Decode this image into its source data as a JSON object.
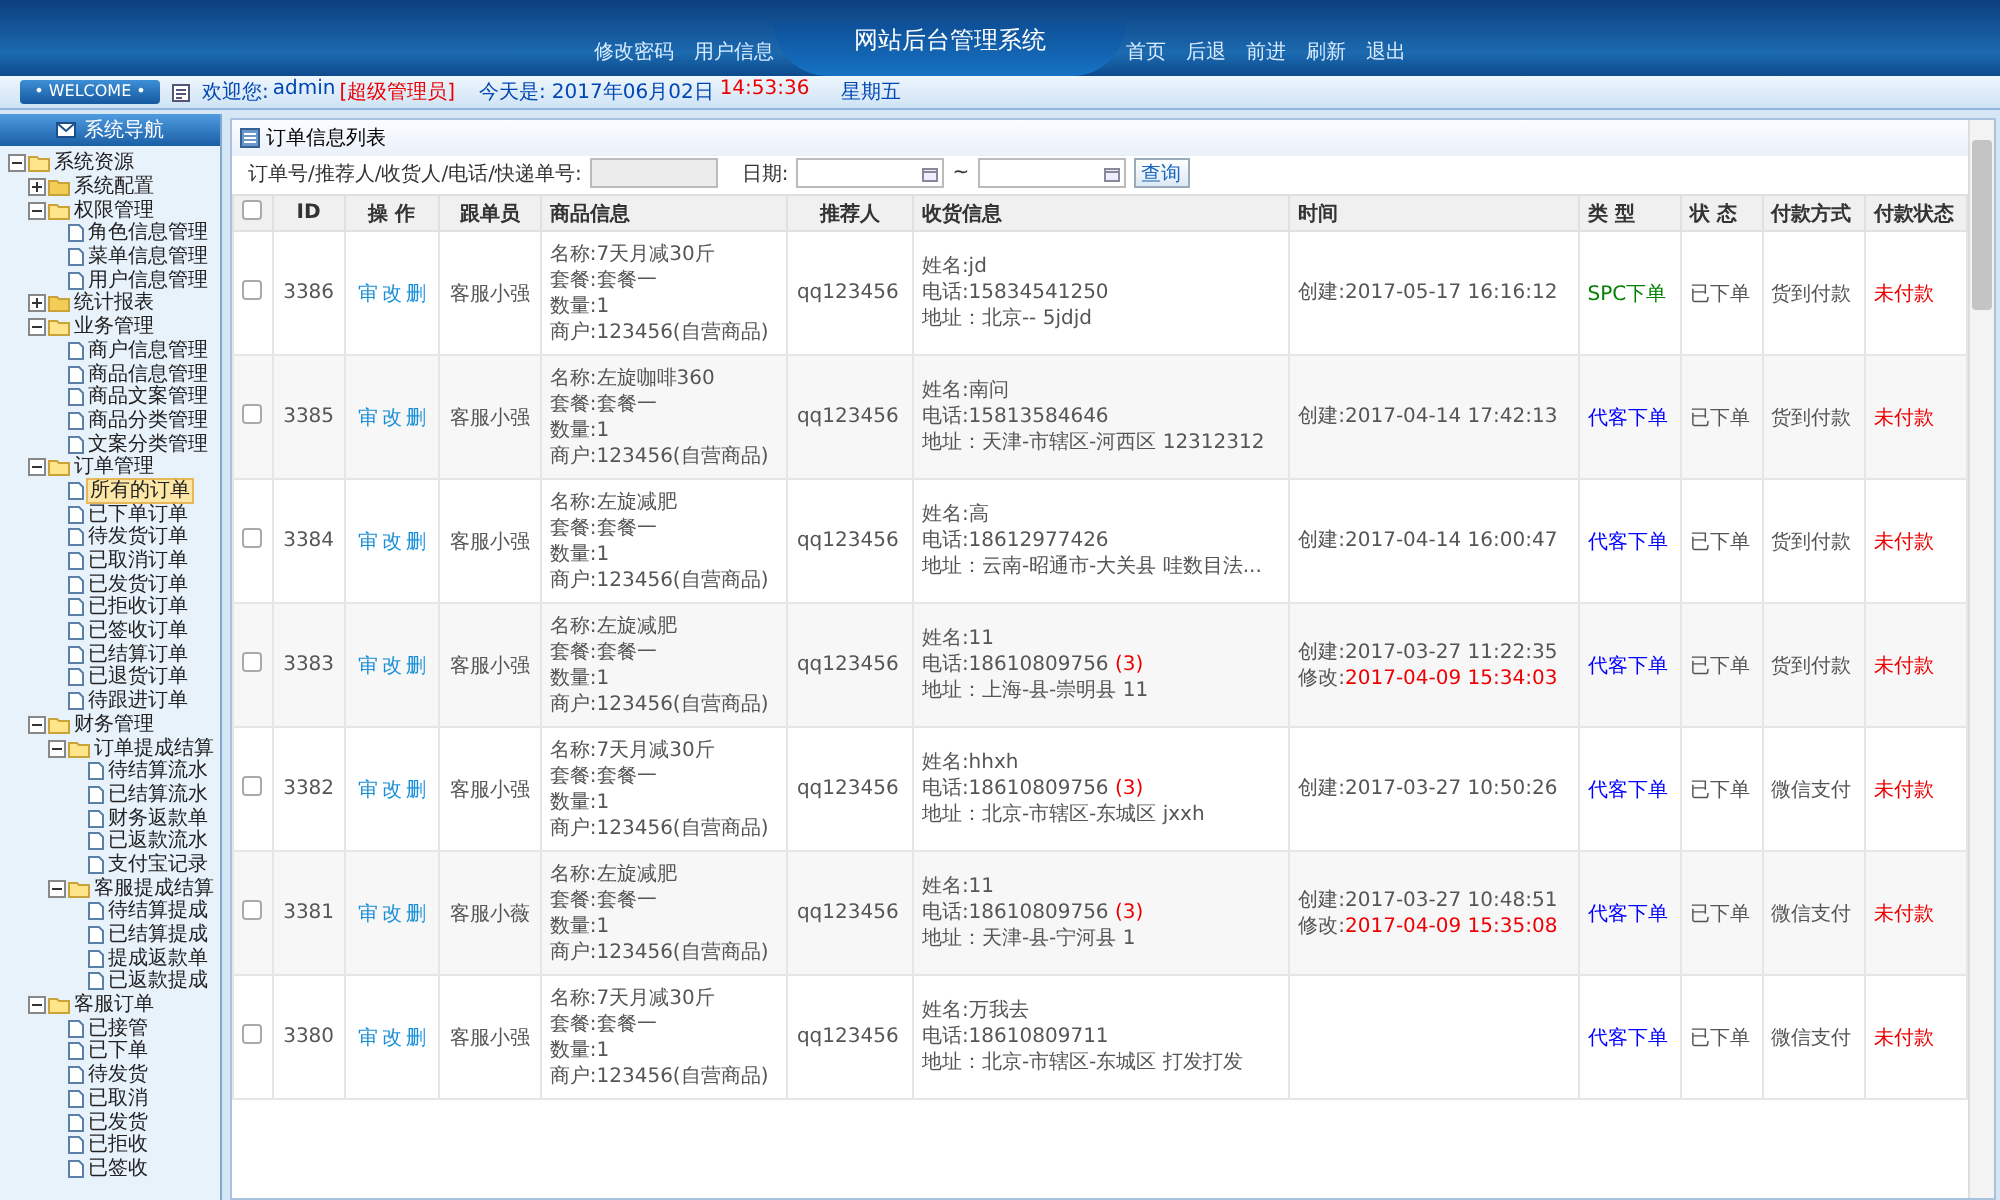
{
  "header": {
    "title": "网站后台管理系统",
    "left_links": [
      "修改密码",
      "用户信息"
    ],
    "right_links": [
      "首页",
      "后退",
      "前进",
      "刷新",
      "退出"
    ]
  },
  "welcome": {
    "badge": "• WELCOME •",
    "greeting": "欢迎您:",
    "user": "admin",
    "role": "[超级管理员]",
    "date_label": "今天是:",
    "date": "2017年06月02日",
    "time": "14:53:36",
    "weekday": "星期五"
  },
  "sidebar": {
    "title": "系统导航",
    "tree": [
      {
        "label": "系统资源",
        "expanded": true,
        "children": [
          {
            "label": "系统配置",
            "expanded": false
          },
          {
            "label": "权限管理",
            "expanded": true,
            "children": [
              {
                "label": "角色信息管理",
                "selected": false
              },
              {
                "label": "菜单信息管理",
                "selected": false
              },
              {
                "label": "用户信息管理",
                "selected": false
              }
            ]
          },
          {
            "label": "统计报表",
            "expanded": false
          },
          {
            "label": "业务管理",
            "expanded": true,
            "children": [
              {
                "label": "商户信息管理",
                "selected": false
              },
              {
                "label": "商品信息管理",
                "selected": false
              },
              {
                "label": "商品文案管理",
                "selected": false
              },
              {
                "label": "商品分类管理",
                "selected": false
              },
              {
                "label": "文案分类管理",
                "selected": false
              }
            ]
          },
          {
            "label": "订单管理",
            "expanded": true,
            "children": [
              {
                "label": "所有的订单",
                "selected": true
              },
              {
                "label": "已下单订单",
                "selected": false
              },
              {
                "label": "待发货订单",
                "selected": false
              },
              {
                "label": "已取消订单",
                "selected": false
              },
              {
                "label": "已发货订单",
                "selected": false
              },
              {
                "label": "已拒收订单",
                "selected": false
              },
              {
                "label": "已签收订单",
                "selected": false
              },
              {
                "label": "已结算订单",
                "selected": false
              },
              {
                "label": "已退货订单",
                "selected": false
              },
              {
                "label": "待跟进订单",
                "selected": false
              }
            ]
          },
          {
            "label": "财务管理",
            "expanded": true,
            "children": [
              {
                "label": "订单提成结算",
                "expanded": true,
                "children": [
                  {
                    "label": "待结算流水",
                    "selected": false
                  },
                  {
                    "label": "已结算流水",
                    "selected": false
                  },
                  {
                    "label": "财务返款单",
                    "selected": false
                  },
                  {
                    "label": "已返款流水",
                    "selected": false
                  },
                  {
                    "label": "支付宝记录",
                    "selected": false
                  }
                ]
              },
              {
                "label": "客服提成结算",
                "expanded": true,
                "children": [
                  {
                    "label": "待结算提成",
                    "selected": false
                  },
                  {
                    "label": "已结算提成",
                    "selected": false
                  },
                  {
                    "label": "提成返款单",
                    "selected": false
                  },
                  {
                    "label": "已返款提成",
                    "selected": false
                  }
                ]
              }
            ]
          },
          {
            "label": "客服订单",
            "expanded": true,
            "children": [
              {
                "label": "已接管",
                "selected": false
              },
              {
                "label": "已下单",
                "selected": false
              },
              {
                "label": "待发货",
                "selected": false
              },
              {
                "label": "已取消",
                "selected": false
              },
              {
                "label": "已发货",
                "selected": false
              },
              {
                "label": "已拒收",
                "selected": false
              },
              {
                "label": "已签收",
                "selected": false
              }
            ]
          }
        ]
      }
    ]
  },
  "panel": {
    "title": "订单信息列表",
    "search_label": "订单号/推荐人/收货人/电话/快递单号:",
    "date_label": "日期:",
    "range_sep": "~",
    "search_button": "查询"
  },
  "table": {
    "select_all": {
      "checked": false
    },
    "columns": [
      "ID",
      "操 作",
      "跟单员",
      "商品信息",
      "推荐人",
      "收货信息",
      "时间",
      "类 型",
      "状 态",
      "付款方式",
      "付款状态"
    ],
    "rows": [
      {
        "checked": false,
        "id": "3386",
        "actions": [
          "审",
          "改",
          "删"
        ],
        "agent": "客服小强",
        "product": [
          "名称:7天月减30斤",
          "套餐:套餐一",
          "数量:1",
          "商户:123456(自营商品)"
        ],
        "referrer": "qq123456",
        "receiver": {
          "name": "姓名:jd",
          "phone": "电话:15834541250",
          "address": "地址：北京-- 5jdjd"
        },
        "created": "创建:2017-05-17 16:16:12",
        "type": {
          "label": "SPC下单",
          "color": "#008000"
        },
        "status": "已下单",
        "payment": "货到付款",
        "pay_status": "未付款"
      },
      {
        "checked": false,
        "id": "3385",
        "actions": [
          "审",
          "改",
          "删"
        ],
        "agent": "客服小强",
        "product": [
          "名称:左旋咖啡360",
          "套餐:套餐一",
          "数量:1",
          "商户:123456(自营商品)"
        ],
        "referrer": "qq123456",
        "receiver": {
          "name": "姓名:南问",
          "phone": "电话:15813584646",
          "address": "地址：天津-市辖区-河西区 12312312"
        },
        "created": "创建:2017-04-14 17:42:13",
        "type": {
          "label": "代客下单",
          "color": "#0000ff"
        },
        "status": "已下单",
        "payment": "货到付款",
        "pay_status": "未付款"
      },
      {
        "checked": false,
        "id": "3384",
        "actions": [
          "审",
          "改",
          "删"
        ],
        "agent": "客服小强",
        "product": [
          "名称:左旋减肥",
          "套餐:套餐一",
          "数量:1",
          "商户:123456(自营商品)"
        ],
        "referrer": "qq123456",
        "receiver": {
          "name": "姓名:高",
          "phone": "电话:18612977426",
          "address": "地址：云南-昭通市-大关县 哇数目法..."
        },
        "created": "创建:2017-04-14 16:00:47",
        "type": {
          "label": "代客下单",
          "color": "#0000ff"
        },
        "status": "已下单",
        "payment": "货到付款",
        "pay_status": "未付款"
      },
      {
        "checked": false,
        "id": "3383",
        "actions": [
          "审",
          "改",
          "删"
        ],
        "agent": "客服小强",
        "product": [
          "名称:左旋减肥",
          "套餐:套餐一",
          "数量:1",
          "商户:123456(自营商品)"
        ],
        "referrer": "qq123456",
        "receiver": {
          "name": "姓名:11",
          "phone": "电话:18610809756",
          "phone_count": "(3)",
          "address": "地址：上海-县-崇明县 11"
        },
        "created": "创建:2017-03-27 11:22:35",
        "modified": {
          "label": "修改:",
          "value": "2017-04-09 15:34:03"
        },
        "type": {
          "label": "代客下单",
          "color": "#0000ff"
        },
        "status": "已下单",
        "payment": "货到付款",
        "pay_status": "未付款"
      },
      {
        "checked": false,
        "id": "3382",
        "actions": [
          "审",
          "改",
          "删"
        ],
        "agent": "客服小强",
        "product": [
          "名称:7天月减30斤",
          "套餐:套餐一",
          "数量:1",
          "商户:123456(自营商品)"
        ],
        "referrer": "qq123456",
        "receiver": {
          "name": "姓名:hhxh",
          "phone": "电话:18610809756",
          "phone_count": "(3)",
          "address": "地址：北京-市辖区-东城区 jxxh"
        },
        "created": "创建:2017-03-27 10:50:26",
        "type": {
          "label": "代客下单",
          "color": "#0000ff"
        },
        "status": "已下单",
        "payment": "微信支付",
        "pay_status": "未付款"
      },
      {
        "checked": false,
        "id": "3381",
        "actions": [
          "审",
          "改",
          "删"
        ],
        "agent": "客服小薇",
        "product": [
          "名称:左旋减肥",
          "套餐:套餐一",
          "数量:1",
          "商户:123456(自营商品)"
        ],
        "referrer": "qq123456",
        "receiver": {
          "name": "姓名:11",
          "phone": "电话:18610809756",
          "phone_count": "(3)",
          "address": "地址：天津-县-宁河县 1"
        },
        "created": "创建:2017-03-27 10:48:51",
        "modified": {
          "label": "修改:",
          "value": "2017-04-09 15:35:08"
        },
        "type": {
          "label": "代客下单",
          "color": "#0000ff"
        },
        "status": "已下单",
        "payment": "微信支付",
        "pay_status": "未付款"
      },
      {
        "checked": false,
        "id": "3380",
        "actions": [
          "审",
          "改",
          "删"
        ],
        "agent": "客服小强",
        "product": [
          "名称:7天月减30斤",
          "套餐:套餐一",
          "数量:1",
          "商户:123456(自营商品)"
        ],
        "referrer": "qq123456",
        "receiver": {
          "name": "姓名:万我去",
          "phone": "电话:18610809711",
          "address": "地址：北京-市辖区-东城区 打发打发"
        },
        "type": {
          "label": "代客下单",
          "color": "#0000ff"
        },
        "status": "已下单",
        "payment": "微信支付",
        "pay_status": "未付款"
      }
    ]
  }
}
